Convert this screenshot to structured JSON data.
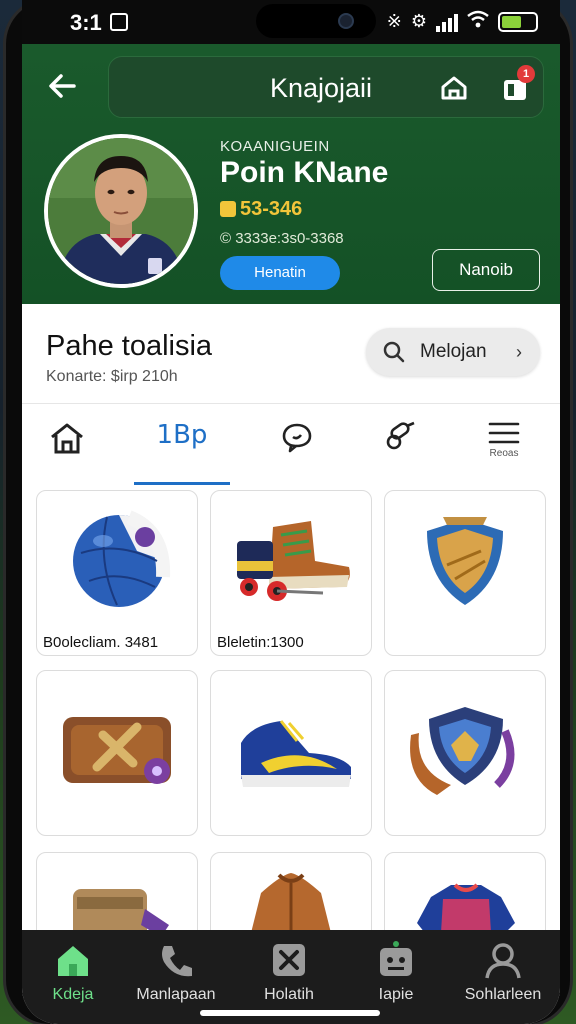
{
  "status": {
    "time": "3:1"
  },
  "header": {
    "title": "Knajojaii",
    "notification_count": "1",
    "profile": {
      "eyebrow": "KOAANIGUEIN",
      "name": "Poin KNane",
      "points": "53-346",
      "meta": "© 3333e:3s0-3368",
      "primary_button": "Henatin",
      "secondary_button": "Nanoib"
    }
  },
  "section": {
    "title": "Pahe toalisia",
    "subtitle": "Konarte: $irp 210h",
    "search_label": "Melojan"
  },
  "tabs": [
    {
      "icon": "home-icon",
      "label": ""
    },
    {
      "icon": "",
      "label": "1Bp"
    },
    {
      "icon": "chat-bubble-icon",
      "label": ""
    },
    {
      "icon": "whistle-icon",
      "label": ""
    },
    {
      "icon": "menu-icon",
      "label": "Reoas"
    }
  ],
  "active_tab": 1,
  "items": [
    {
      "icon": "ball-icon",
      "caption": "B0olecliam. 3481"
    },
    {
      "icon": "boot-icon",
      "caption": "Bleletin:1300"
    },
    {
      "icon": "shield-badge-icon",
      "caption": ""
    },
    {
      "icon": "chest-icon",
      "caption": ""
    },
    {
      "icon": "sneaker-icon",
      "caption": ""
    },
    {
      "icon": "crest-icon",
      "caption": ""
    },
    {
      "icon": "belt-icon",
      "caption": ""
    },
    {
      "icon": "jacket-icon",
      "caption": ""
    },
    {
      "icon": "jersey-icon",
      "caption": ""
    }
  ],
  "bottom_nav": [
    {
      "label": "Kdeja",
      "icon": "home-icon",
      "active": true
    },
    {
      "label": "Manlapaan",
      "icon": "phone-icon",
      "active": false
    },
    {
      "label": "Holatih",
      "icon": "x-box-icon",
      "active": false
    },
    {
      "label": "Iapie",
      "icon": "robot-icon",
      "active": false
    },
    {
      "label": "Sohlarleen",
      "icon": "person-icon",
      "active": false
    }
  ],
  "colors": {
    "header_green": "#1a5a2c",
    "accent_blue": "#1f8ae8",
    "points_gold": "#f2c53a",
    "active_nav": "#6ee08a"
  }
}
